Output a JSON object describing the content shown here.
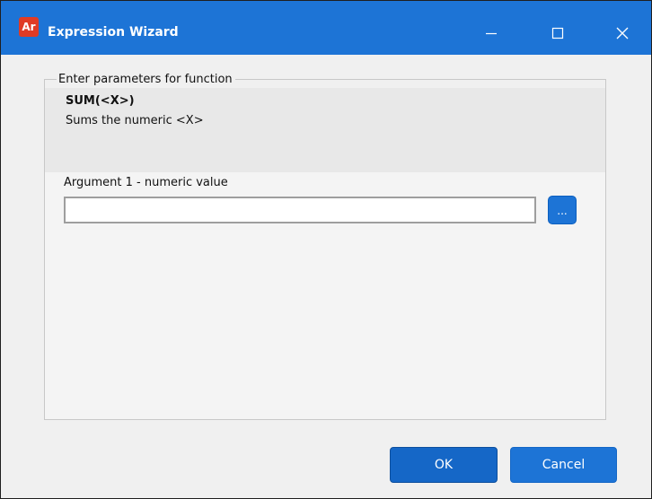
{
  "window": {
    "title": "Expression Wizard",
    "app_icon_text": "Ar"
  },
  "titlebar_controls": {
    "minimize_icon": "minimize-icon",
    "maximize_icon": "maximize-icon",
    "close_icon": "close-icon"
  },
  "group": {
    "legend": "Enter parameters for function"
  },
  "function": {
    "name": "SUM(<X>)",
    "description": "Sums the numeric <X>"
  },
  "argument1": {
    "label": "Argument 1 - numeric value",
    "value": "",
    "browse_label": "..."
  },
  "buttons": {
    "ok_label": "OK",
    "cancel_label": "Cancel"
  },
  "colors": {
    "titlebar": "#1d74d6",
    "accent": "#1d74d6",
    "dialog_background": "#f0f0f0",
    "app_icon": "#e03b25"
  }
}
